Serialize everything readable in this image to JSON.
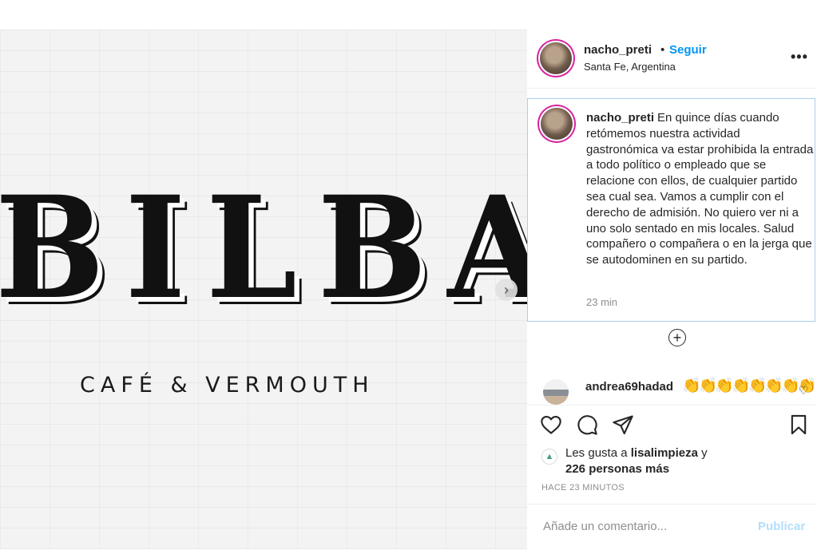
{
  "photo": {
    "brand_text": "BILBAO",
    "tagline": "CAFÉ & VERMOUTH",
    "next_glyph": "›"
  },
  "header": {
    "username": "nacho_preti",
    "separator": "•",
    "follow_label": "Seguir",
    "location": "Santa Fe, Argentina",
    "more_glyph": "•••"
  },
  "caption": {
    "username": "nacho_preti",
    "text": "En quince días cuando retómemos nuestra actividad gastronómica va estar prohibida la entrada a todo político o empleado que se relacione con ellos, de cualquier partido sea cual sea. Vamos a cumplir con el derecho de admisión. No quiero ver ni a uno solo sentado en mis locales. Salud compañero o compañera o en la jerga que se autodominen en su partido.",
    "time": "23 min"
  },
  "load_more_glyph": "+",
  "comment": {
    "username": "andrea69hadad",
    "emoji": "👏👏👏👏👏👏👏👏",
    "like_glyph": "♡"
  },
  "likes": {
    "prefix": "Les gusta a",
    "user": "lisalimpieza",
    "conj": "y",
    "others": "226 personas más"
  },
  "time_ago": "HACE 23 MINUTOS",
  "comment_input": {
    "placeholder": "Añade un comentario...",
    "publish_label": "Publicar"
  },
  "colors": {
    "link_blue": "#0095f6",
    "publish_disabled": "#b2dffc",
    "caption_focus_border": "#a9cdee",
    "muted_text": "#8e8e8e"
  },
  "icons": [
    "heart-icon",
    "comment-icon",
    "share-icon",
    "bookmark-icon",
    "add-circle-icon",
    "more-icon",
    "chevron-right-icon"
  ]
}
